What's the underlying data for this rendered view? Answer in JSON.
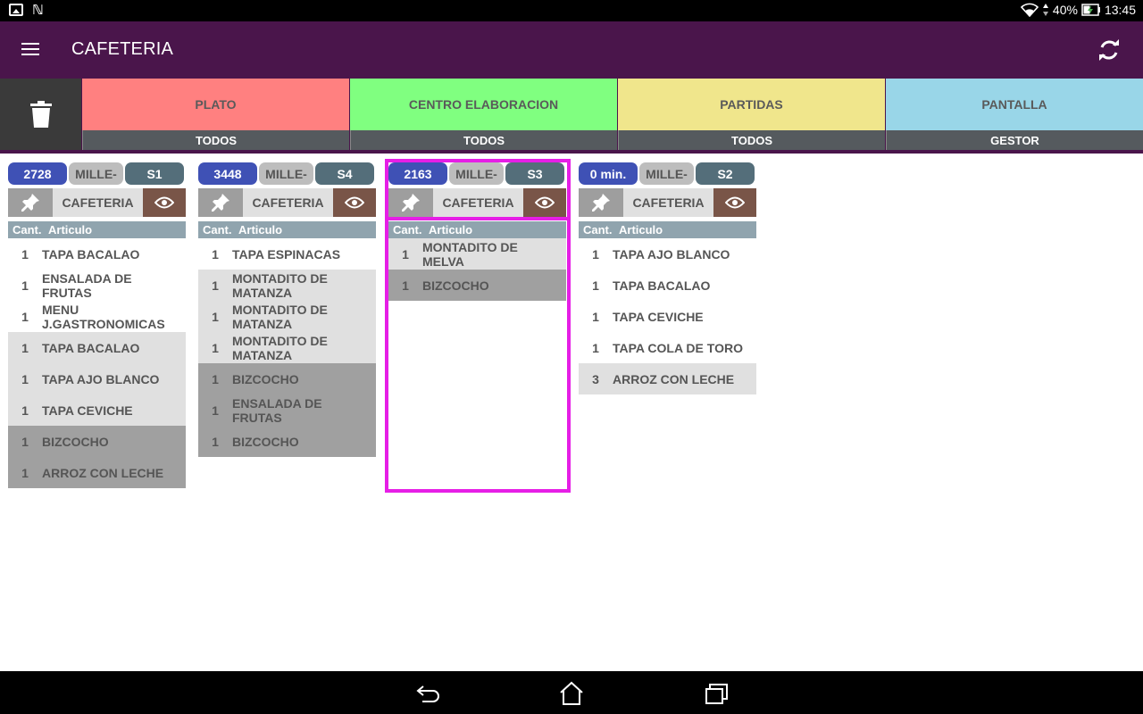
{
  "status_bar": {
    "battery": "40%",
    "time": "13:45",
    "icons": [
      "image-icon",
      "n-icon",
      "wifi-icon",
      "data-arrows-icon",
      "battery-charging-icon"
    ]
  },
  "app_bar": {
    "title": "CAFETERIA",
    "icons": [
      "menu-icon",
      "refresh-icon"
    ]
  },
  "filters": [
    {
      "label": "PLATO",
      "value": "TODOS",
      "color": "#ff8080"
    },
    {
      "label": "CENTRO ELABORACION",
      "value": "TODOS",
      "color": "#80ff80"
    },
    {
      "label": "PARTIDAS",
      "value": "TODOS",
      "color": "#f0e68c"
    },
    {
      "label": "PANTALLA",
      "value": "GESTOR",
      "color": "#99d6e8"
    }
  ],
  "colors": {
    "primary": "#4a154b",
    "order_number": "#3f51b5",
    "section": "#546e7a",
    "eye_button": "#795548",
    "selection": "#e61ee6"
  },
  "table_headers": {
    "qty": "Cant.",
    "article": "Articulo"
  },
  "orders": [
    {
      "number": "2728",
      "waiter": "MILLE-",
      "section": "S1",
      "category": "CAFETERIA",
      "items": [
        {
          "qty": "1",
          "name": "TAPA BACALAO"
        },
        {
          "qty": "1",
          "name": "ENSALADA DE FRUTAS"
        },
        {
          "qty": "1",
          "name": "MENU J.GASTRONOMICAS"
        },
        {
          "qty": "1",
          "name": "TAPA BACALAO"
        },
        {
          "qty": "1",
          "name": "TAPA AJO BLANCO"
        },
        {
          "qty": "1",
          "name": "TAPA CEVICHE"
        },
        {
          "qty": "1",
          "name": "BIZCOCHO"
        },
        {
          "qty": "1",
          "name": "ARROZ CON LECHE"
        }
      ]
    },
    {
      "number": "3448",
      "waiter": "MILLE-",
      "section": "S4",
      "category": "CAFETERIA",
      "items": [
        {
          "qty": "1",
          "name": "TAPA ESPINACAS"
        },
        {
          "qty": "1",
          "name": "MONTADITO DE MATANZA"
        },
        {
          "qty": "1",
          "name": "MONTADITO DE MATANZA"
        },
        {
          "qty": "1",
          "name": "MONTADITO DE MATANZA"
        },
        {
          "qty": "1",
          "name": "BIZCOCHO"
        },
        {
          "qty": "1",
          "name": "ENSALADA DE FRUTAS"
        },
        {
          "qty": "1",
          "name": "BIZCOCHO"
        }
      ]
    },
    {
      "number": "2163",
      "waiter": "MILLE-",
      "section": "S3",
      "category": "CAFETERIA",
      "items": [
        {
          "qty": "1",
          "name": "MONTADITO DE MELVA"
        },
        {
          "qty": "1",
          "name": "BIZCOCHO"
        }
      ]
    },
    {
      "number": "0 min.",
      "waiter": "MILLE-",
      "section": "S2",
      "category": "CAFETERIA",
      "items": [
        {
          "qty": "1",
          "name": "TAPA AJO BLANCO"
        },
        {
          "qty": "1",
          "name": "TAPA BACALAO"
        },
        {
          "qty": "1",
          "name": "TAPA CEVICHE"
        },
        {
          "qty": "1",
          "name": "TAPA COLA DE TORO"
        },
        {
          "qty": "3",
          "name": "ARROZ CON LECHE"
        }
      ]
    }
  ],
  "nav_bar": {
    "icons": [
      "back-icon",
      "home-icon",
      "recents-icon"
    ]
  }
}
